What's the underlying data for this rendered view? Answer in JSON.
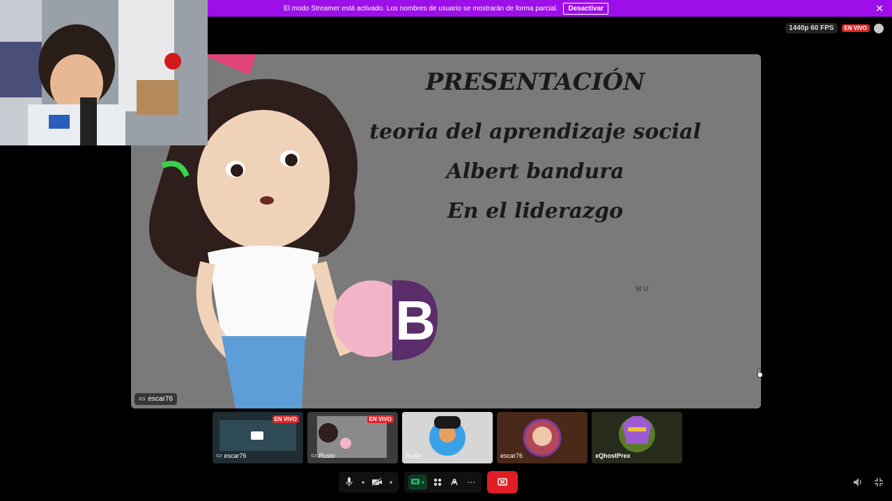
{
  "banner": {
    "message": "El modo Streamer está activado. Los nombres de usuario se mostrarán de forma parcial.",
    "button": "Desactivar",
    "close_icon": "close-icon",
    "color": "#9d0fe8"
  },
  "streaminfo": {
    "quality": "1440p 60 FPS",
    "live": "EN VIVO",
    "chat_icon": "chat-icon"
  },
  "stage": {
    "title": "PRESENTACIÓN",
    "line1": "teoria del aprendizaje social",
    "line2": "Albert bandura",
    "line3": "En el liderazgo",
    "mark": "M U",
    "letter": "B",
    "streamer_name": "escar76"
  },
  "thumbnails": [
    {
      "name": "escar76",
      "live": "EN VIVO"
    },
    {
      "name": "Rusio",
      "live": "EN VIVO"
    },
    {
      "name": "Rusio",
      "live": ""
    },
    {
      "name": "escar76",
      "live": ""
    },
    {
      "name": "xQhostPrex",
      "live": ""
    }
  ],
  "colors": {
    "live": "#e0262a",
    "leave": "#e21d24",
    "screen_share": "#1fbf63",
    "accent": "#9d0fe8"
  }
}
